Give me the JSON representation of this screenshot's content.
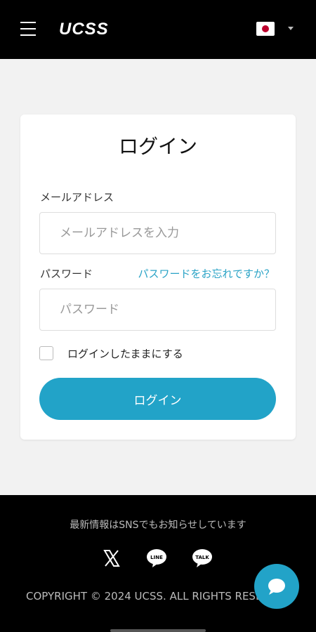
{
  "header": {
    "menu_icon": "hamburger-icon",
    "logo": "UCSS",
    "language_icon": "japan-flag-icon",
    "language_caret_icon": "caret-down-icon"
  },
  "login": {
    "title": "ログイン",
    "email_label": "メールアドレス",
    "email_placeholder": "メールアドレスを入力",
    "email_value": "",
    "password_label": "パスワード",
    "forgot_link": "パスワードをお忘れですか？",
    "password_placeholder": "パスワード",
    "password_value": "",
    "remember_label": "ログインしたままにする",
    "remember_checked": false,
    "submit_label": "ログイン"
  },
  "footer": {
    "sns_text": "最新情報はSNSでもお知らせしています",
    "social_icons": [
      "x-icon",
      "line-icon",
      "kakaotalk-icon"
    ],
    "copyright": "COPYRIGHT © 2024 UCSS. ALL RIGHTS RESE"
  },
  "colors": {
    "accent": "#22a3c8",
    "header_bg": "#000000",
    "page_bg": "#f2f2f2"
  }
}
